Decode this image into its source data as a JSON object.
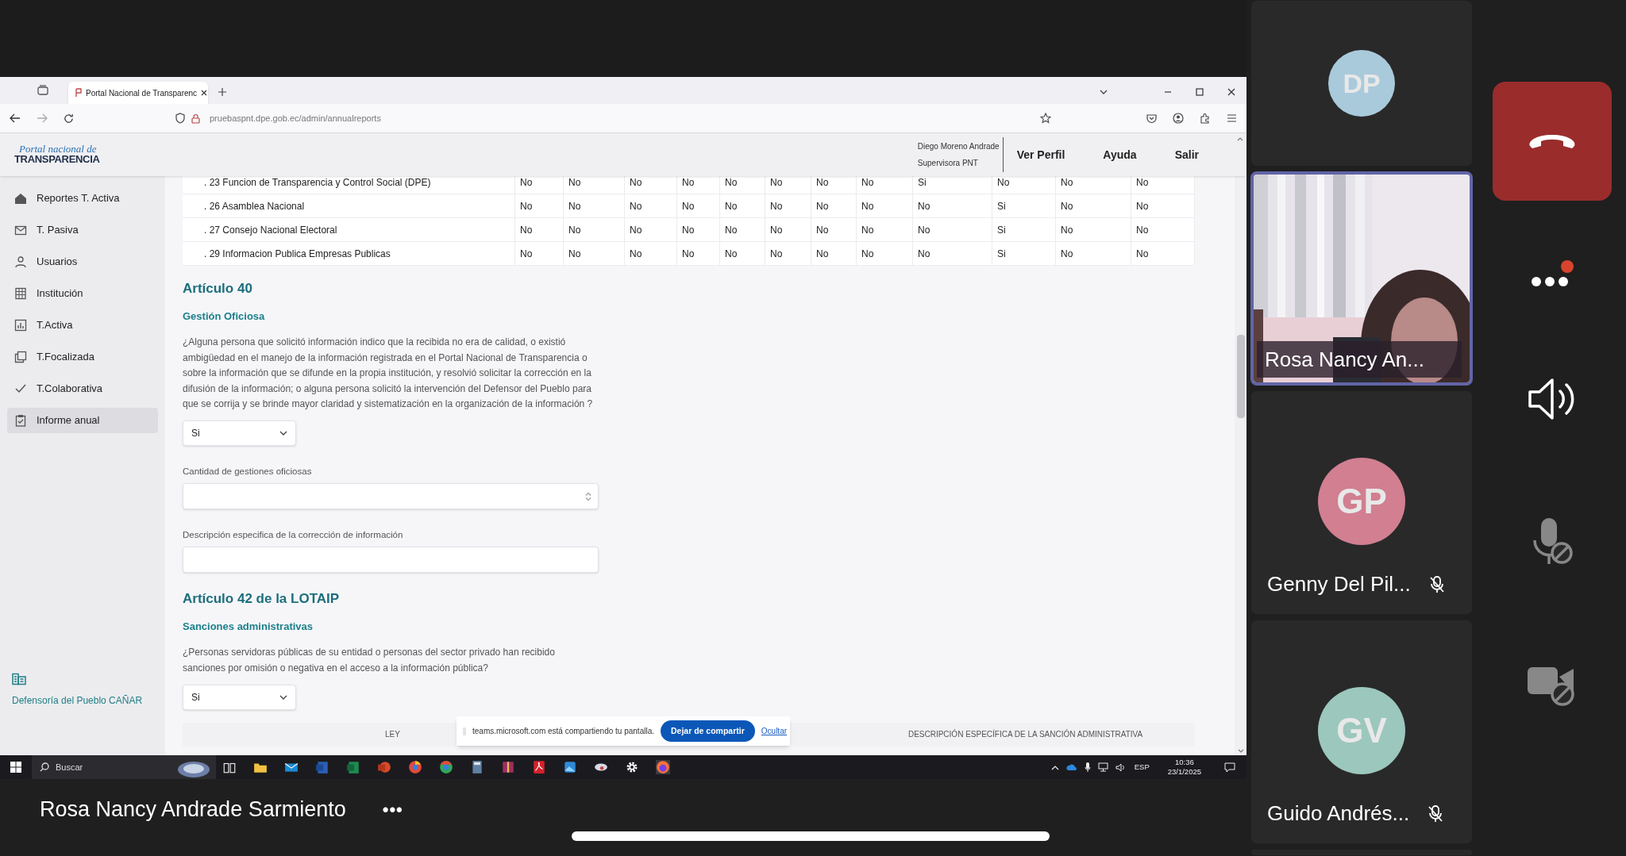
{
  "browser": {
    "tab_title": "Portal Nacional de Transparenc",
    "url": "pruebaspnt.dpe.gob.ec/admin/annualreports"
  },
  "app": {
    "logo_script": "Portal nacional de",
    "logo_title": "TRANSPARENCIA",
    "user_name": "Diego Moreno Andrade",
    "user_role": "Supervisora PNT",
    "nav": [
      "Ver Perfil",
      "Ayuda",
      "Salir"
    ]
  },
  "sidebar": {
    "items": [
      {
        "label": "Reportes T. Activa",
        "selected": false
      },
      {
        "label": "T. Pasiva",
        "selected": false
      },
      {
        "label": "Usuarios",
        "selected": false
      },
      {
        "label": "Institución",
        "selected": false
      },
      {
        "label": "T.Activa",
        "selected": false
      },
      {
        "label": "T.Focalizada",
        "selected": false
      },
      {
        "label": "T.Colaborativa",
        "selected": false
      },
      {
        "label": "Informe anual",
        "selected": true
      }
    ],
    "footer": "Defensoría del Pueblo CAÑAR"
  },
  "table": {
    "rows": [
      {
        "label": ". 23 Funcion de Transparencia y Control Social (DPE)",
        "values": [
          "No",
          "No",
          "No",
          "No",
          "No",
          "No",
          "No",
          "No",
          "Si",
          "No",
          "No",
          "No"
        ]
      },
      {
        "label": ". 26 Asamblea Nacional",
        "values": [
          "No",
          "No",
          "No",
          "No",
          "No",
          "No",
          "No",
          "No",
          "No",
          "Si",
          "No",
          "No"
        ]
      },
      {
        "label": ". 27 Consejo Nacional Electoral",
        "values": [
          "No",
          "No",
          "No",
          "No",
          "No",
          "No",
          "No",
          "No",
          "No",
          "Si",
          "No",
          "No"
        ]
      },
      {
        "label": ". 29 Informacion Publica Empresas Publicas",
        "values": [
          "No",
          "No",
          "No",
          "No",
          "No",
          "No",
          "No",
          "No",
          "No",
          "Si",
          "No",
          "No"
        ]
      }
    ]
  },
  "sections": [
    {
      "title": "Artículo 40",
      "subtitle": "Gestión Oficiosa",
      "question": "¿Alguna persona que solicitó información indico que la recibida no era de calidad, o existió ambigüedad en el manejo de la información registrada en el Portal Nacional de Transparencia o sobre la información que se difunde en la propia institución, y resolvió solicitar la corrección en la difusión de la información; o alguna persona solicitó la intervención del Defensor del Pueblo para que se corrija y se brinde mayor claridad y sistematización en la organización de la información ?",
      "answer": "Si",
      "fields": [
        {
          "kind": "number",
          "label": "Cantidad de gestiones oficiosas"
        },
        {
          "kind": "text",
          "label": "Descripción especifica de la corrección de información"
        }
      ]
    },
    {
      "title": "Artículo 42 de la LOTAIP",
      "subtitle": "Sanciones administrativas",
      "question": "¿Personas servidoras públicas de su entidad o personas del sector privado han recibido sanciones por omisión o negativa en el acceso a la información pública?",
      "answer": "Si",
      "columns": [
        "LEY",
        "DESCRIPCIÓN ESPECÍFICA DE LA SANCIÓN ADMINISTRATIVA"
      ]
    }
  ],
  "share_bar": {
    "message": "teams.microsoft.com está compartiendo tu pantalla.",
    "stop_button": "Dejar de compartir",
    "hide_link": "Ocultar"
  },
  "taskbar": {
    "search_placeholder": "Buscar",
    "language": "ESP",
    "time": "10:36",
    "date": "23/1/2025"
  },
  "presenter": {
    "name": "Rosa Nancy Andrade Sarmiento",
    "more": "•••"
  },
  "participants": [
    {
      "kind": "avatar",
      "initials": "DP",
      "color": "#a9cadb"
    },
    {
      "kind": "video",
      "name": "Rosa Nancy An...",
      "speaking": true
    },
    {
      "kind": "avatar",
      "initials": "GP",
      "color": "#d17f91",
      "name": "Genny Del Pil...",
      "muted": true
    },
    {
      "kind": "avatar",
      "initials": "GV",
      "color": "#9cc7bc",
      "name": "Guido Andrés...",
      "muted": true
    }
  ]
}
